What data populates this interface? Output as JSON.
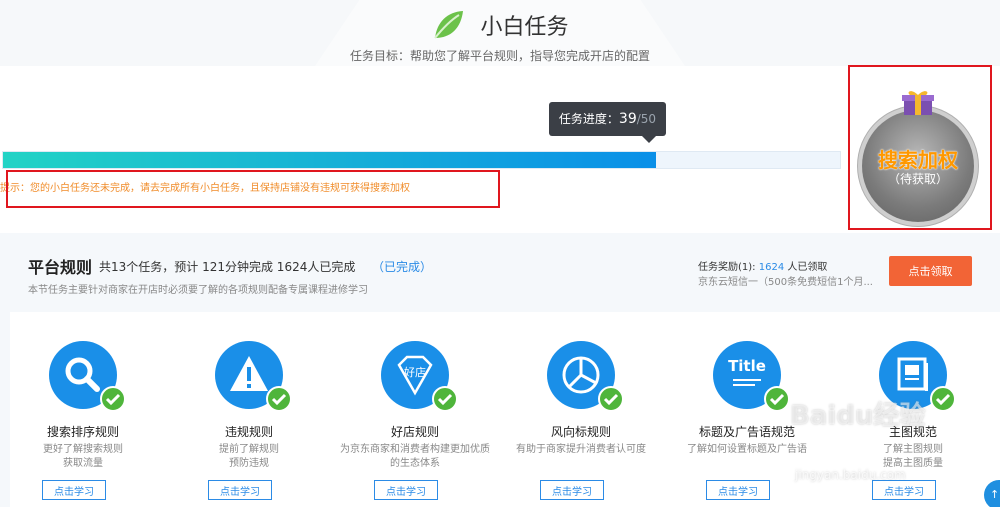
{
  "header": {
    "title": "小白任务",
    "subtitle": "任务目标：帮助您了解平台规则，指导您完成开店的配置"
  },
  "progress": {
    "label": "任务进度：",
    "current": "39",
    "separator": "/",
    "total": "50",
    "fraction": 0.78,
    "tip": "提示：您的小白任务还未完成，请去完成所有小白任务，且保持店铺没有违规可获得搜索加权"
  },
  "badge": {
    "title": "搜索加权",
    "status": "（待获取）"
  },
  "section": {
    "title": "平台规则",
    "meta": "共13个任务，预计 121分钟完成 1624人已完成",
    "done": "（已完成）",
    "desc": "本节任务主要针对商家在开店时必须要了解的各项规则配备专属课程进修学习",
    "reward_label": "任务奖励(1):",
    "reward_count": "1624",
    "reward_suffix": "人已领取",
    "reward_detail": "京东云短信一（500条免费短信1个月...",
    "claim_label": "点击领取"
  },
  "cards": [
    {
      "name": "搜索排序规则",
      "desc": "更好了解搜索规则\n获取流量",
      "icon": "magnifier-icon",
      "button": "点击学习"
    },
    {
      "name": "违规规则",
      "desc": "提前了解规则\n预防违规",
      "icon": "warning-icon",
      "button": "点击学习"
    },
    {
      "name": "好店规则",
      "desc": "为京东商家和消费者构建更加优质\n的生态体系",
      "icon": "diamond-icon",
      "icon_text": "好店",
      "button": "点击学习"
    },
    {
      "name": "风向标规则",
      "desc": "有助于商家提升消费者认可度",
      "icon": "pie-chart-icon",
      "button": "点击学习"
    },
    {
      "name": "标题及广告语规范",
      "desc": "了解如何设置标题及广告语",
      "icon": "title-icon",
      "icon_text": "Title",
      "button": "点击学习"
    },
    {
      "name": "主图规范",
      "desc": "了解主图规则\n提高主图质量",
      "icon": "image-frame-icon",
      "button": "点击学习"
    }
  ],
  "watermark": {
    "logo": "Baidu经验",
    "url": "jingyan.baidu.com"
  },
  "colors": {
    "accent": "#1a8fe8",
    "orange": "#f26436",
    "check": "#4fb53b",
    "highlight": "#e0161e"
  }
}
